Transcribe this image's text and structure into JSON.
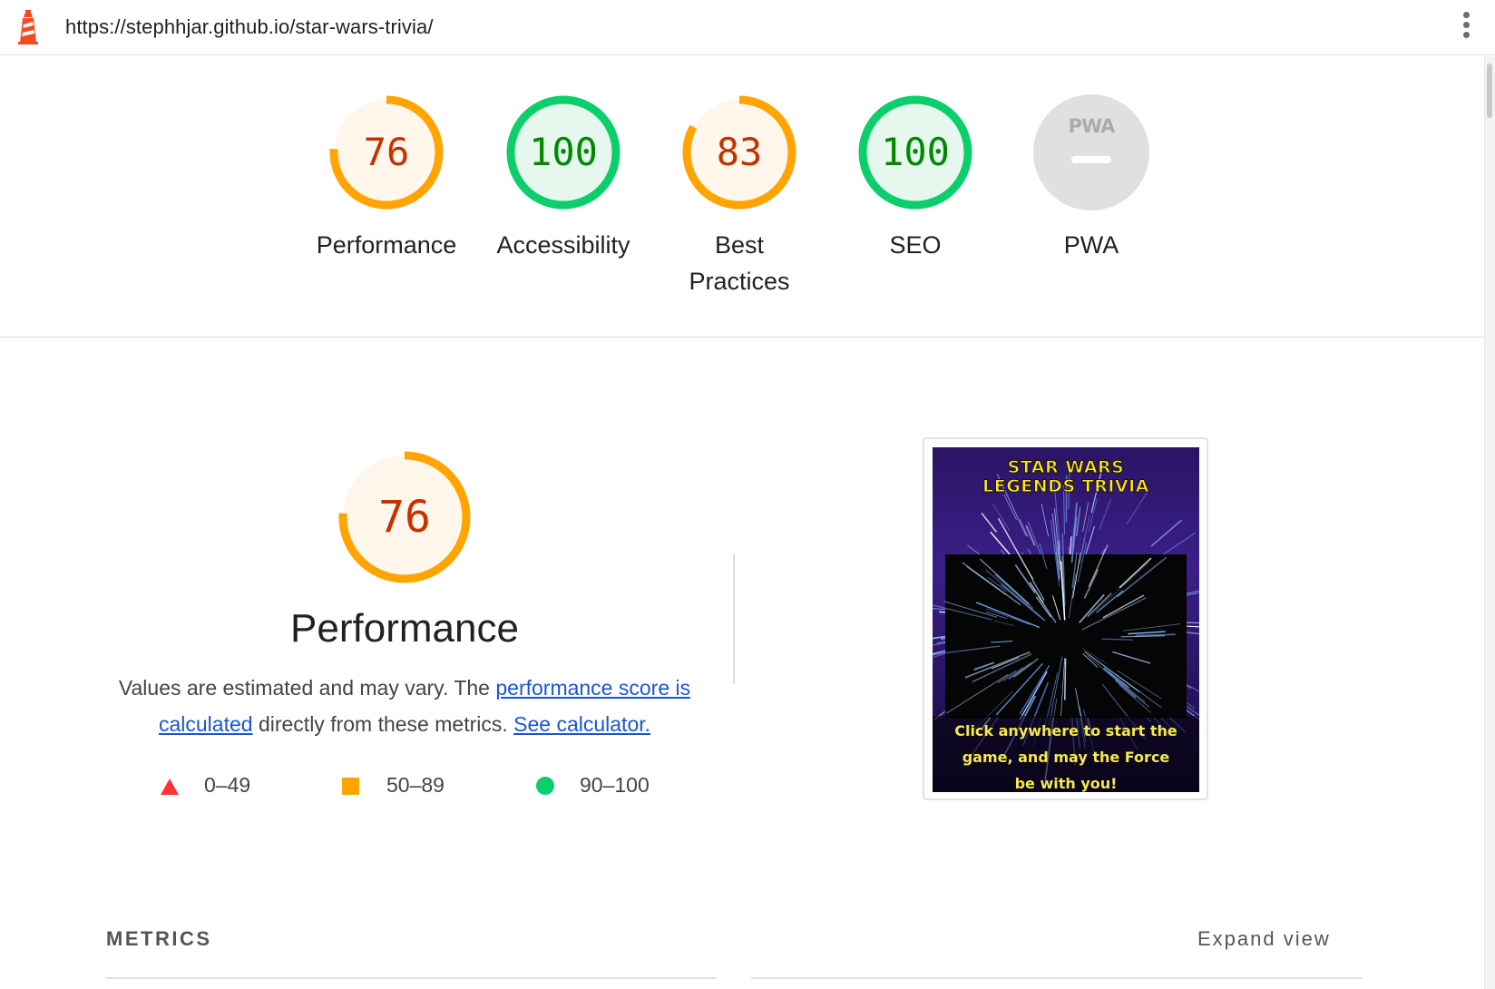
{
  "browser": {
    "url": "https://stephhjar.github.io/star-wars-trivia/"
  },
  "colors": {
    "average": "#ffa400",
    "average_text": "#c33300",
    "average_bg": "#fff6ec",
    "pass": "#0cce6b",
    "pass_text": "#008800",
    "pass_bg": "#e6f8ee",
    "fail": "#ff3333",
    "pwa_gray": "#e0e0e0",
    "link": "#1a55d6"
  },
  "categories": [
    {
      "name": "Performance",
      "score": "76",
      "fraction": 0.76,
      "rating": "average"
    },
    {
      "name": "Accessibility",
      "score": "100",
      "fraction": 1.0,
      "rating": "pass"
    },
    {
      "name": "Best Practices",
      "line1": "Best",
      "line2": "Practices",
      "score": "83",
      "fraction": 0.83,
      "rating": "average"
    },
    {
      "name": "SEO",
      "score": "100",
      "fraction": 1.0,
      "rating": "pass"
    },
    {
      "name": "PWA",
      "badge": "PWA",
      "rating": "na"
    }
  ],
  "performance": {
    "score": "76",
    "fraction": 0.76,
    "title": "Performance",
    "desc_prefix": "Values are estimated and may vary. The ",
    "desc_link1": "performance score is calculated",
    "desc_middle": " directly from these metrics. ",
    "desc_link2": "See calculator."
  },
  "legend": [
    {
      "shape": "triangle",
      "range": "0–49"
    },
    {
      "shape": "square",
      "range": "50–89"
    },
    {
      "shape": "circle",
      "range": "90–100"
    }
  ],
  "screenshot": {
    "title_line1": "STAR WARS",
    "title_line2": "LEGENDS TRIVIA",
    "message": "Click anywhere to start the game, and may the Force be with you!"
  },
  "metrics": {
    "heading": "METRICS",
    "expand_label": "Expand view"
  }
}
